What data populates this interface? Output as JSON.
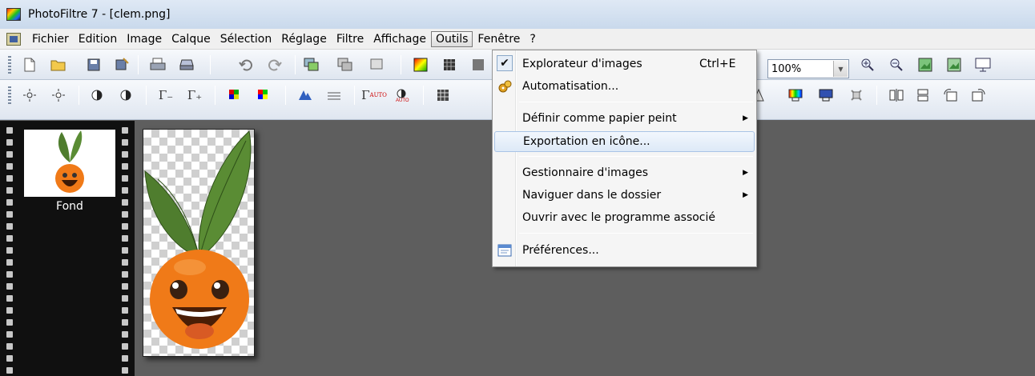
{
  "window": {
    "title": "PhotoFiltre 7 - [clem.png]"
  },
  "menubar": {
    "items": [
      "Fichier",
      "Edition",
      "Image",
      "Calque",
      "Sélection",
      "Réglage",
      "Filtre",
      "Affichage",
      "Outils",
      "Fenêtre",
      "?"
    ],
    "active": "Outils"
  },
  "toolbar": {
    "zoom_value": "100%"
  },
  "layers": {
    "layer_name": "Fond"
  },
  "outils_menu": {
    "items": [
      {
        "label": "Explorateur d'images",
        "shortcut": "Ctrl+E",
        "checked": true
      },
      {
        "label": "Automatisation..."
      },
      {
        "label": "Définir comme papier peint",
        "submenu": true
      },
      {
        "label": "Exportation en icône...",
        "highlighted": true
      },
      {
        "label": "Gestionnaire d'images",
        "submenu": true
      },
      {
        "label": "Naviguer dans le dossier",
        "submenu": true
      },
      {
        "label": "Ouvrir avec le programme associé"
      },
      {
        "label": "Préférences..."
      }
    ]
  },
  "colors": {
    "highlight_border": "#a9c4e6",
    "canvas_bg": "#5e5e5e",
    "orange": "#f07a18",
    "leaf": "#4f7d2e"
  }
}
